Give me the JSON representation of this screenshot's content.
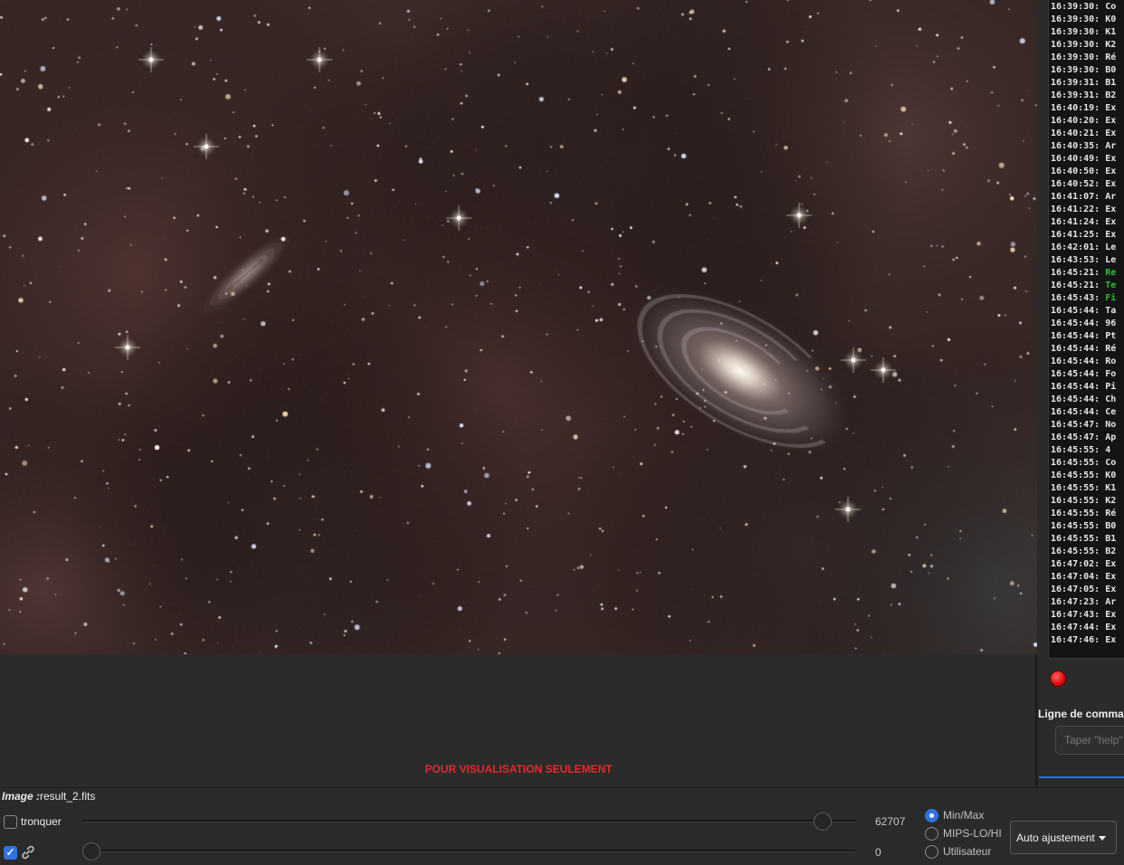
{
  "viewer": {
    "preview_note": "POUR VISUALISATION SEULEMENT"
  },
  "console": {
    "lines": [
      {
        "time": "16:39:30:",
        "msg": "Co"
      },
      {
        "time": "16:39:30:",
        "msg": "K0"
      },
      {
        "time": "16:39:30:",
        "msg": "K1"
      },
      {
        "time": "16:39:30:",
        "msg": "K2"
      },
      {
        "time": "16:39:30:",
        "msg": "Ré"
      },
      {
        "time": "16:39:30:",
        "msg": "B0"
      },
      {
        "time": "16:39:31:",
        "msg": "B1"
      },
      {
        "time": "16:39:31:",
        "msg": "B2"
      },
      {
        "time": "16:40:19:",
        "msg": "Ex"
      },
      {
        "time": "16:40:20:",
        "msg": "Ex"
      },
      {
        "time": "16:40:21:",
        "msg": "Ex"
      },
      {
        "time": "16:40:35:",
        "msg": "Ar"
      },
      {
        "time": "16:40:49:",
        "msg": "Ex"
      },
      {
        "time": "16:40:50:",
        "msg": "Ex"
      },
      {
        "time": "16:40:52:",
        "msg": "Ex"
      },
      {
        "time": "16:41:07:",
        "msg": "Ar"
      },
      {
        "time": "16:41:22:",
        "msg": "Ex"
      },
      {
        "time": "16:41:24:",
        "msg": "Ex"
      },
      {
        "time": "16:41:25:",
        "msg": "Ex"
      },
      {
        "time": "16:42:01:",
        "msg": "Le"
      },
      {
        "time": "16:43:53:",
        "msg": "Le"
      },
      {
        "time": "16:45:21:",
        "msg": "Re",
        "color": "green"
      },
      {
        "time": "16:45:21:",
        "msg": "Te",
        "color": "green"
      },
      {
        "time": "16:45:43:",
        "msg": "Fi",
        "color": "green"
      },
      {
        "time": "16:45:44:",
        "msg": "Ta"
      },
      {
        "time": "16:45:44:",
        "msg": "96"
      },
      {
        "time": "16:45:44:",
        "msg": "Pt"
      },
      {
        "time": "16:45:44:",
        "msg": "Ré"
      },
      {
        "time": "16:45:44:",
        "msg": "Ro"
      },
      {
        "time": "16:45:44:",
        "msg": "Fo"
      },
      {
        "time": "16:45:44:",
        "msg": "Pi"
      },
      {
        "time": "16:45:44:",
        "msg": "Ch"
      },
      {
        "time": "16:45:44:",
        "msg": "Ce"
      },
      {
        "time": "16:45:47:",
        "msg": "No"
      },
      {
        "time": "16:45:47:",
        "msg": "Ap"
      },
      {
        "time": "16:45:55:",
        "msg": "4"
      },
      {
        "time": "16:45:55:",
        "msg": "Co"
      },
      {
        "time": "16:45:55:",
        "msg": "K0"
      },
      {
        "time": "16:45:55:",
        "msg": "K1"
      },
      {
        "time": "16:45:55:",
        "msg": "K2"
      },
      {
        "time": "16:45:55:",
        "msg": "Ré"
      },
      {
        "time": "16:45:55:",
        "msg": "B0"
      },
      {
        "time": "16:45:55:",
        "msg": "B1"
      },
      {
        "time": "16:45:55:",
        "msg": "B2"
      },
      {
        "time": "16:47:02:",
        "msg": "Ex"
      },
      {
        "time": "16:47:04:",
        "msg": "Ex"
      },
      {
        "time": "16:47:05:",
        "msg": "Ex"
      },
      {
        "time": "16:47:23:",
        "msg": "Ar"
      },
      {
        "time": "16:47:43:",
        "msg": "Ex"
      },
      {
        "time": "16:47:44:",
        "msg": "Ex"
      },
      {
        "time": "16:47:46:",
        "msg": "Ex"
      }
    ],
    "colors": {
      "green": "#2fbf2f",
      "default": "#e6e6e6"
    }
  },
  "command": {
    "label": "Ligne de commande",
    "placeholder": "Taper \"help\""
  },
  "image_info": {
    "key": "Image :",
    "filename": "result_2.fits"
  },
  "controls": {
    "crop_label": "tronquer",
    "crop_checked": false,
    "link_checked": true,
    "max_value": "62707",
    "min_value": "0",
    "max_slider_fraction": 0.957,
    "min_slider_fraction": 0.0,
    "radio_options": [
      {
        "label": "Min/Max",
        "selected": true
      },
      {
        "label": "MIPS-LO/HI",
        "selected": false
      },
      {
        "label": "Utilisateur",
        "selected": false
      }
    ],
    "auto_button_label": "Auto ajustement"
  },
  "accent_color": "#2f73e0"
}
